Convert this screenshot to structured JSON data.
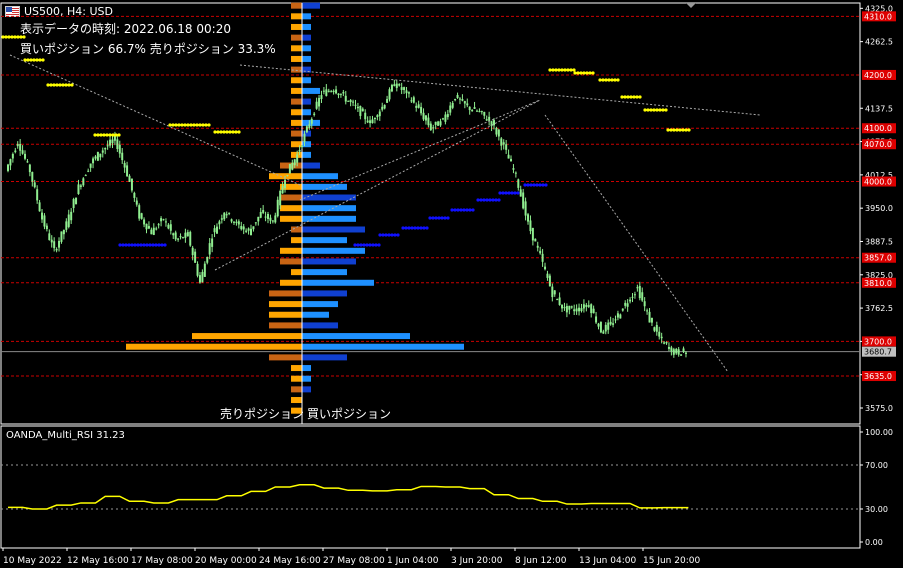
{
  "header": {
    "title": "US500, H4:  USD",
    "time_label": "表示データの時刻: 2022.06.18 00:20",
    "positions_label": "買いポジション 66.7% 売りポジション 33.3%",
    "sell_label": "売りポジション",
    "buy_label": "買いポジション"
  },
  "rsi_panel": {
    "title": "OANDA_Multi_RSI 31.23"
  },
  "colors": {
    "background": "#000000",
    "candle": "#90EE90",
    "buy_bar": "#1E90FF",
    "buy_bar_dark": "#1040d0",
    "sell_bar": "#FFA500",
    "sell_bar_dark": "#C86414",
    "level_line": "#CC0000",
    "level_tag": "#DD0000",
    "dots_yellow": "#FFFF00",
    "dots_blue": "#1010FF",
    "rsi_line": "#FFFF00",
    "grid_dotted": "#AAAAAA",
    "current_price_tag": "#C0C0C0"
  },
  "chart_data": [
    {
      "type": "candlestick",
      "symbol": "US500",
      "timeframe": "H4",
      "price_axis_ticks": [
        "4325.0",
        "4262.5",
        "4137.5",
        "4075.0",
        "4012.5",
        "3950.0",
        "3887.5",
        "3825.0",
        "3762.5",
        "3700.0",
        "3637.5",
        "3575.0"
      ],
      "price_range": [
        3545,
        4335
      ],
      "level_lines": [
        "4310.0",
        "4200.0",
        "4100.0",
        "4070.0",
        "4000.0",
        "3857.0",
        "3810.0",
        "3700.0",
        "3635.0"
      ],
      "current_price": "3680.7",
      "x_tick_labels": [
        "10 May 2022",
        "12 May 16:00",
        "17 May 08:00",
        "20 May 00:00",
        "24 May 16:00",
        "27 May 08:00",
        "1 Jun 04:00",
        "3 Jun 20:00",
        "8 Jun 12:00",
        "13 Jun 04:00",
        "15 Jun 20:00"
      ],
      "close_path": [
        [
          0,
          4020
        ],
        [
          5,
          4075
        ],
        [
          10,
          4020
        ],
        [
          15,
          3930
        ],
        [
          20,
          3870
        ],
        [
          25,
          3920
        ],
        [
          30,
          3990
        ],
        [
          35,
          4035
        ],
        [
          40,
          4060
        ],
        [
          45,
          4080
        ],
        [
          50,
          4015
        ],
        [
          55,
          3935
        ],
        [
          60,
          3905
        ],
        [
          65,
          3930
        ],
        [
          70,
          3890
        ],
        [
          75,
          3900
        ],
        [
          80,
          3810
        ],
        [
          85,
          3900
        ],
        [
          90,
          3945
        ],
        [
          95,
          3920
        ],
        [
          100,
          3905
        ],
        [
          105,
          3940
        ],
        [
          110,
          3925
        ],
        [
          115,
          4010
        ],
        [
          120,
          4050
        ],
        [
          125,
          4110
        ],
        [
          130,
          4165
        ],
        [
          135,
          4175
        ],
        [
          140,
          4155
        ],
        [
          145,
          4135
        ],
        [
          150,
          4110
        ],
        [
          155,
          4140
        ],
        [
          160,
          4185
        ],
        [
          165,
          4165
        ],
        [
          170,
          4135
        ],
        [
          175,
          4100
        ],
        [
          180,
          4115
        ],
        [
          185,
          4160
        ],
        [
          190,
          4140
        ],
        [
          195,
          4130
        ],
        [
          200,
          4110
        ],
        [
          205,
          4065
        ],
        [
          210,
          4010
        ],
        [
          215,
          3920
        ],
        [
          220,
          3860
        ],
        [
          225,
          3790
        ],
        [
          230,
          3760
        ],
        [
          235,
          3760
        ],
        [
          240,
          3770
        ],
        [
          245,
          3720
        ],
        [
          250,
          3735
        ],
        [
          255,
          3770
        ],
        [
          260,
          3800
        ],
        [
          265,
          3740
        ],
        [
          270,
          3700
        ],
        [
          275,
          3680
        ],
        [
          280,
          3680
        ]
      ],
      "close_path_x_units": "H4 bar index"
    },
    {
      "type": "bar",
      "name": "Position book",
      "price_levels": [
        4330,
        4310,
        4290,
        4270,
        4250,
        4230,
        4210,
        4190,
        4170,
        4150,
        4130,
        4110,
        4090,
        4070,
        4050,
        4030,
        4010,
        3990,
        3970,
        3950,
        3930,
        3910,
        3890,
        3870,
        3850,
        3830,
        3810,
        3790,
        3770,
        3750,
        3730,
        3710,
        3690,
        3670,
        3650,
        3630,
        3610,
        3590,
        3570
      ],
      "series": [
        {
          "name": "買いポジション",
          "values": [
            2,
            1,
            1,
            1,
            1,
            1,
            1,
            1,
            2,
            1,
            1,
            2,
            1,
            1,
            1,
            2,
            4,
            5,
            6,
            6,
            6,
            7,
            5,
            7,
            6,
            5,
            8,
            5,
            4,
            3,
            4,
            12,
            18,
            5,
            1,
            1,
            1,
            0,
            0
          ]
        },
        {
          "name": "売りポジション",
          "values": [
            1,
            1,
            1,
            1,
            1,
            1,
            1,
            1,
            1,
            1,
            1,
            1,
            1,
            1,
            1,
            2,
            3,
            2,
            2,
            2,
            2,
            1,
            1,
            2,
            2,
            1,
            2,
            3,
            3,
            3,
            3,
            10,
            16,
            3,
            1,
            1,
            1,
            1,
            1
          ]
        }
      ],
      "unit": "relative"
    },
    {
      "type": "line",
      "name": "OANDA_Multi_RSI",
      "ylim": [
        0,
        100
      ],
      "y_ticks": [
        "100.00",
        "70.00",
        "30.00",
        "0.00"
      ],
      "x": [
        0,
        10,
        20,
        30,
        40,
        50,
        60,
        70,
        80,
        90,
        100,
        110,
        120,
        130,
        140,
        150,
        160,
        170,
        180,
        190,
        200,
        210,
        220,
        230,
        240,
        250,
        260,
        270,
        280
      ],
      "values": [
        31.5,
        30,
        33.5,
        35.5,
        41.5,
        37,
        35.5,
        38.5,
        38.5,
        42,
        46,
        50,
        52,
        49,
        47,
        46.5,
        47.5,
        50.5,
        50,
        48.5,
        43,
        39.5,
        37,
        34.5,
        35,
        35,
        31,
        31.2,
        31.23
      ]
    }
  ]
}
